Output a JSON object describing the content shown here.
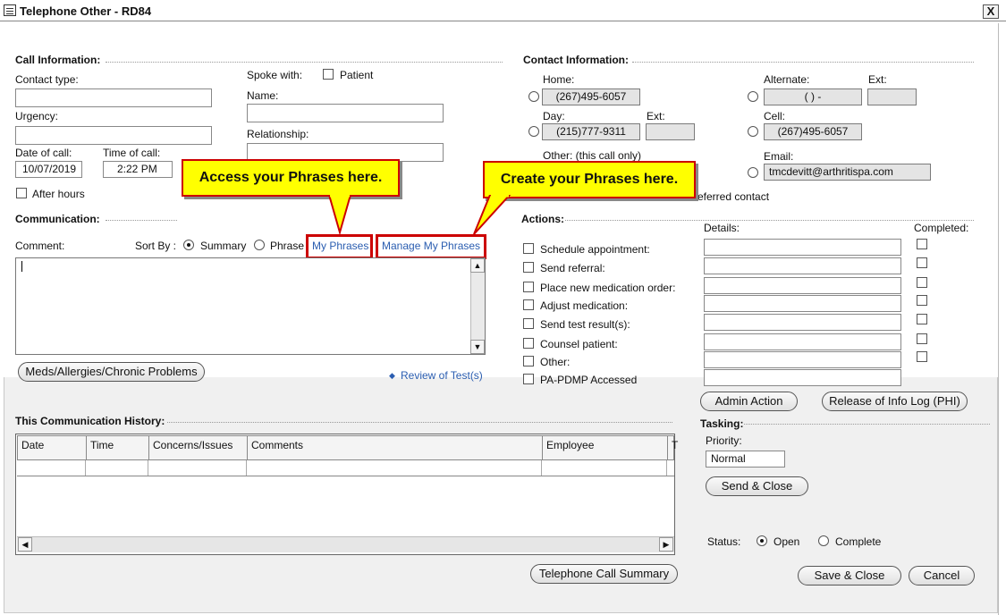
{
  "window": {
    "title": "Telephone Other - RD84",
    "close": "X"
  },
  "call_info": {
    "heading": "Call Information:",
    "contact_type_label": "Contact type:",
    "contact_type": "",
    "urgency_label": "Urgency:",
    "urgency": "",
    "date_label": "Date of call:",
    "date": "10/07/2019",
    "time_label": "Time of call:",
    "time": "2:22 PM",
    "after_hours": "After hours",
    "spoke_with": "Spoke with:",
    "patient": "Patient",
    "name_label": "Name:",
    "name": "",
    "relationship_label": "Relationship:",
    "relationship": ""
  },
  "contact_info": {
    "heading": "Contact Information:",
    "home_label": "Home:",
    "home": "(267)495-6057",
    "day_label": "Day:",
    "day": "(215)777-9311",
    "ext_label": "Ext:",
    "other_label": "Other:  (this call only)",
    "alternate_label": "Alternate:",
    "alternate": "(   )   -",
    "alt_ext_label": "Ext:",
    "cell_label": "Cell:",
    "cell": "(267)495-6057",
    "email_label": "Email:",
    "email": "tmcdevitt@arthritispa.com",
    "preferred": "referred contact"
  },
  "communication": {
    "heading": "Communication:",
    "comment_label": "Comment:",
    "sort_by": "Sort By :",
    "summary": "Summary",
    "phrase": "Phrase",
    "my_phrases": "My Phrases",
    "manage_phrases": "Manage My Phrases",
    "meds_button": "Meds/Allergies/Chronic Problems",
    "review": "Review of Test(s)"
  },
  "callouts": {
    "access": "Access your Phrases here.",
    "create": "Create your Phrases here."
  },
  "actions": {
    "heading": "Actions:",
    "details": "Details:",
    "completed": "Completed:",
    "items": [
      "Schedule appointment:",
      "Send referral:",
      "Place new medication order:",
      "Adjust medication:",
      "Send test result(s):",
      "Counsel patient:",
      "Other:",
      "PA-PDMP Accessed"
    ],
    "admin_action": "Admin Action",
    "release_log": "Release of Info Log (PHI)"
  },
  "tasking": {
    "heading": "Tasking:",
    "priority_label": "Priority:",
    "priority": "Normal",
    "send_close": "Send & Close"
  },
  "history": {
    "heading": "This Communication History:",
    "columns": [
      "Date",
      "Time",
      "Concerns/Issues",
      "Comments",
      "Employee",
      "T"
    ],
    "summary_button": "Telephone Call Summary"
  },
  "status": {
    "label": "Status:",
    "open": "Open",
    "complete": "Complete"
  },
  "footer": {
    "save_close": "Save & Close",
    "cancel": "Cancel"
  },
  "icons": {
    "app": "form-icon",
    "close": "close-icon",
    "scroll_up": "arrow-up-icon",
    "scroll_down": "arrow-down-icon",
    "scroll_left": "arrow-left-icon",
    "scroll_right": "arrow-right-icon",
    "review": "diamond-icon"
  }
}
